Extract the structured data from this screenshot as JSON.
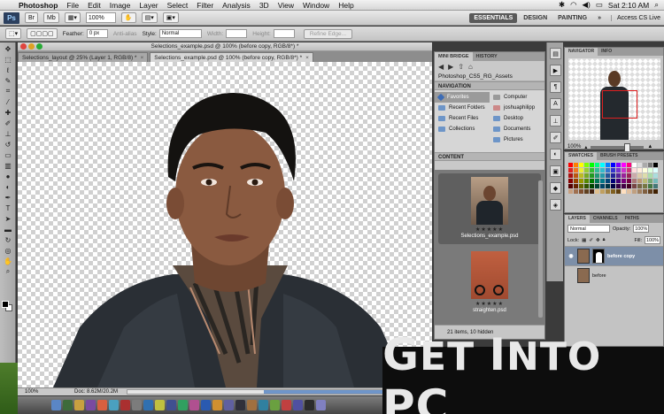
{
  "menubar": {
    "app": "Photoshop",
    "items": [
      "File",
      "Edit",
      "Image",
      "Layer",
      "Select",
      "Filter",
      "Analysis",
      "3D",
      "View",
      "Window",
      "Help"
    ],
    "clock": "Sat 2:10 AM"
  },
  "appbar": {
    "logo": "Ps",
    "zoom": "100%",
    "workspaces": [
      "ESSENTIALS",
      "DESIGN",
      "PAINTING"
    ],
    "more": "»",
    "cs_live": "Access CS Live"
  },
  "options": {
    "feather_label": "Feather:",
    "feather_value": "0 px",
    "antialias": "Anti-alias",
    "style_label": "Style:",
    "style_value": "Normal",
    "width_label": "Width:",
    "height_label": "Height:",
    "refine": "Refine Edge..."
  },
  "document": {
    "window_title": "Selections_example.psd @ 100% (before copy, RGB/8*) *",
    "tabs": [
      {
        "label": "Selections_layout @ 25% (Layer 1, RGB/8) *"
      },
      {
        "label": "Selections_example.psd @ 100% (before copy, RGB/8*) *"
      }
    ],
    "status_zoom": "100%",
    "status_doc": "Doc: 8.62M/20.2M"
  },
  "mini_bridge": {
    "tabs": [
      "MINI BRIDGE",
      "HISTORY"
    ],
    "path": "Photoshop_CS5_RG_Assets",
    "nav_header": "NAVIGATION",
    "favorites": [
      "Favorites",
      "Recent Folders",
      "Recent Files",
      "Collections"
    ],
    "places": [
      "Computer",
      "joshuaphilipp",
      "Desktop",
      "Documents",
      "Pictures"
    ],
    "content_header": "CONTENT",
    "thumbs": [
      {
        "stars": "★★★★★",
        "name": "Selections_example.psd"
      },
      {
        "stars": "★★★★★",
        "name": "straighten.psd"
      }
    ],
    "footer": "21 items, 10 hidden"
  },
  "navigator": {
    "tabs": [
      "NAVIGATOR",
      "INFO"
    ],
    "zoom": "100%"
  },
  "swatches": {
    "tabs": [
      "SWATCHES",
      "BRUSH PRESETS"
    ],
    "colors": [
      "#ff0000",
      "#ff7f00",
      "#ffff00",
      "#7fff00",
      "#00ff00",
      "#00ff7f",
      "#00ffff",
      "#007fff",
      "#0000ff",
      "#7f00ff",
      "#ff00ff",
      "#ff007f",
      "#ffffff",
      "#dddddd",
      "#aaaaaa",
      "#777777",
      "#000000",
      "#d22",
      "#e72",
      "#ee3",
      "#9c3",
      "#3b3",
      "#3b9",
      "#3bc",
      "#37c",
      "#33c",
      "#73c",
      "#c3c",
      "#c37",
      "#fdd",
      "#fed",
      "#ffd",
      "#dfd",
      "#dff",
      "#a11",
      "#b51",
      "#bb2",
      "#7a2",
      "#292",
      "#297",
      "#29a",
      "#259",
      "#229",
      "#529",
      "#929",
      "#925",
      "#caa",
      "#dca",
      "#dda",
      "#ada",
      "#add",
      "#800",
      "#940",
      "#990",
      "#580",
      "#070",
      "#075",
      "#078",
      "#047",
      "#007",
      "#407",
      "#707",
      "#704",
      "#a77",
      "#b97",
      "#bb7",
      "#7a7",
      "#7bb",
      "#500",
      "#620",
      "#660",
      "#350",
      "#040",
      "#043",
      "#046",
      "#034",
      "#004",
      "#304",
      "#404",
      "#402",
      "#744",
      "#764",
      "#774",
      "#474",
      "#477",
      "#c8a080",
      "#a07050",
      "#805030",
      "#604020",
      "#402010",
      "#e0c090",
      "#c0a060",
      "#a08040",
      "#806020",
      "#604010",
      "#ffe0c0",
      "#e0c0a0",
      "#c0a080",
      "#a08060",
      "#806040",
      "#604020",
      "#402000"
    ]
  },
  "layers": {
    "tabs": [
      "LAYERS",
      "CHANNELS",
      "PATHS"
    ],
    "blend": "Normal",
    "opacity_label": "Opacity:",
    "opacity": "100%",
    "lock_label": "Lock:",
    "fill_label": "Fill:",
    "fill": "100%",
    "items": [
      {
        "name": "before copy",
        "visible": true,
        "selected": true
      },
      {
        "name": "before",
        "visible": false,
        "selected": false
      }
    ]
  },
  "watermark": {
    "text_parts": [
      "G",
      "ET ",
      "I",
      "NTO ",
      "PC"
    ]
  }
}
